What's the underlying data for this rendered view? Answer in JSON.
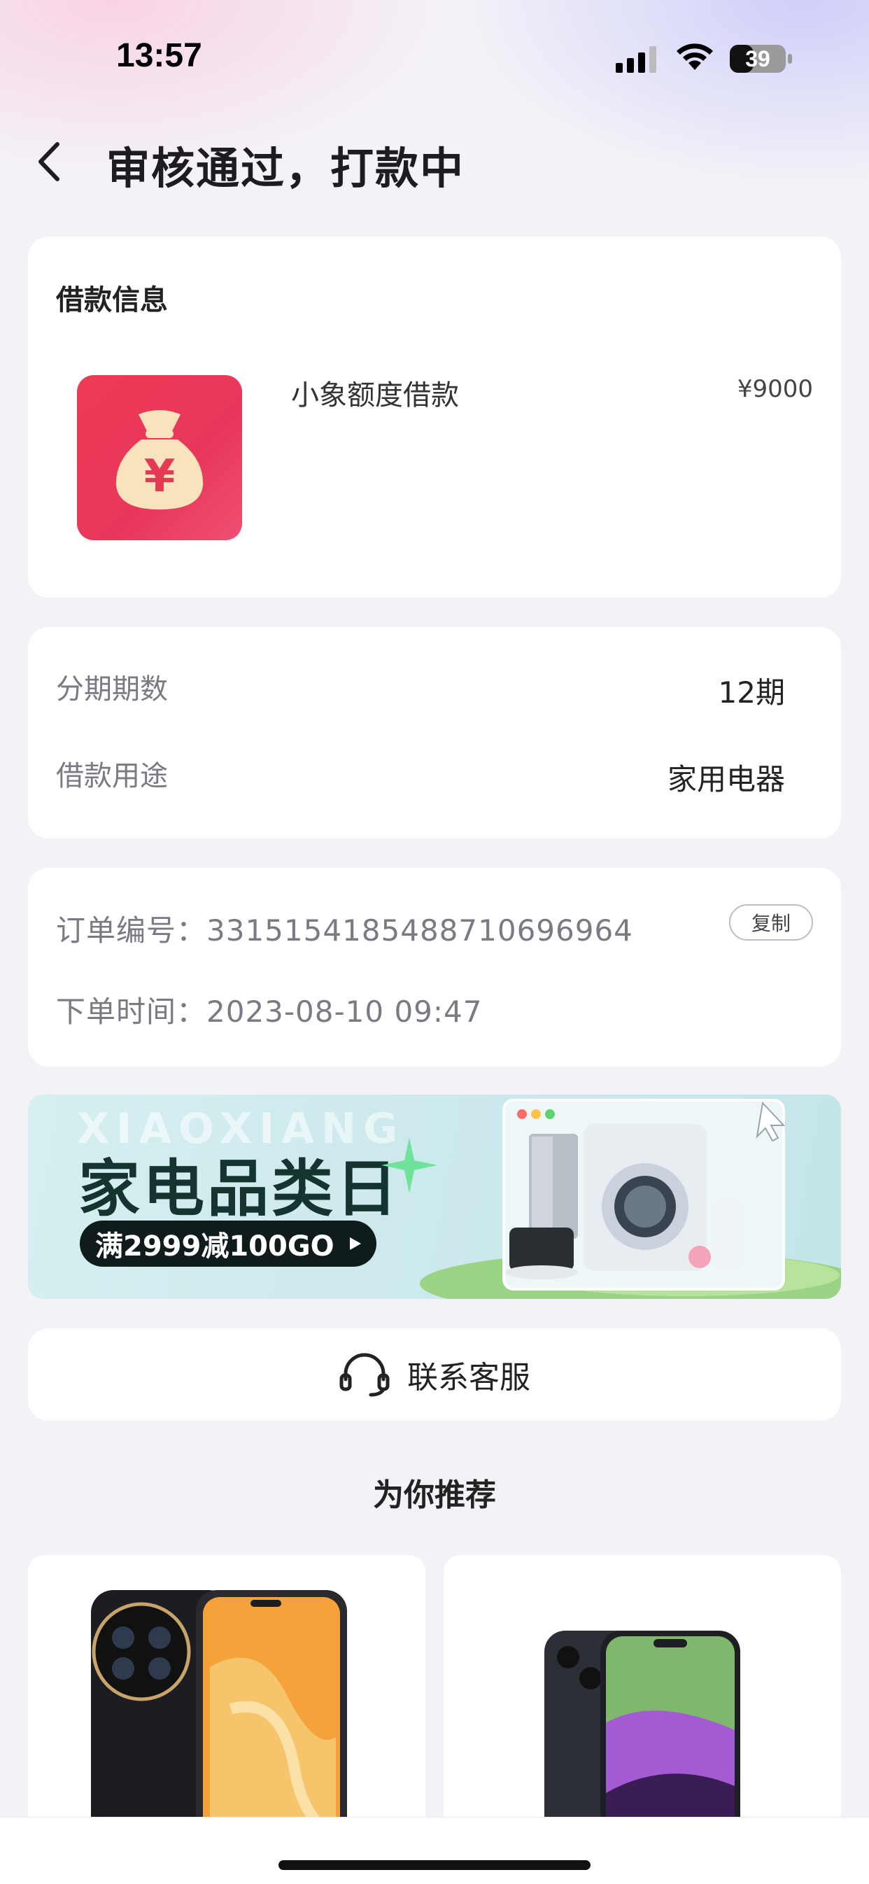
{
  "status_bar": {
    "time": "13:57",
    "battery": "39"
  },
  "header": {
    "title": "审核通过，打款中"
  },
  "loan_info": {
    "heading": "借款信息",
    "product_name": "小象额度借款",
    "amount": "¥9000",
    "icon_symbol": "¥"
  },
  "terms": {
    "installments_label": "分期期数",
    "installments_value": "12期",
    "purpose_label": "借款用途",
    "purpose_value": "家用电器"
  },
  "order": {
    "number_label": "订单编号：",
    "number_value": "3315154185488710696964",
    "time_label": "下单时间：",
    "time_value": "2023-08-10 09:47",
    "copy_label": "复制"
  },
  "banner": {
    "watermark": "XIAOXIANG",
    "title": "家电品类日",
    "promo": "满2999减100GO"
  },
  "service": {
    "label": "联系客服"
  },
  "recommend": {
    "title": "为你推荐"
  },
  "colors": {
    "accent_red": "#ea3a58",
    "banner_bg": "#cde9ec"
  }
}
